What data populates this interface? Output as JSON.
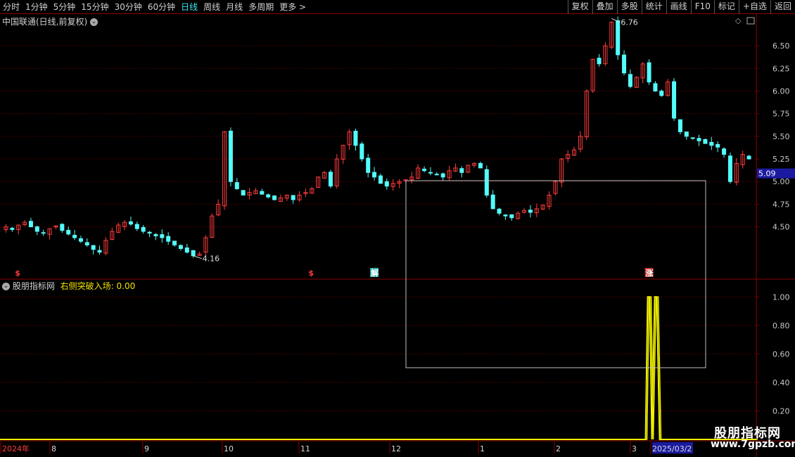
{
  "toolbar": {
    "periods": [
      "分时",
      "1分钟",
      "5分钟",
      "15分钟",
      "30分钟",
      "60分钟",
      "日线",
      "周线",
      "月线",
      "多周期",
      "更多 >"
    ],
    "active_period": "日线",
    "buttons": [
      "复权",
      "叠加",
      "多股",
      "统计",
      "画线",
      "F10",
      "标记",
      "+自选",
      "返回"
    ]
  },
  "main_chart": {
    "title": "中国联通(日线,前复权)",
    "price_ticks": [
      "6.50",
      "6.25",
      "6.00",
      "5.75",
      "5.50",
      "5.25",
      "5.00",
      "4.75",
      "4.50"
    ],
    "high_label": "6.76",
    "low_label": "4.16",
    "last_price": "5.09",
    "markers": [
      "$",
      "$",
      "解",
      "涨"
    ]
  },
  "indicator": {
    "name": "股朋指标网",
    "formula_label": "右侧突破入场: 0.00",
    "ticks": [
      "1.00",
      "0.80",
      "0.60",
      "0.40",
      "0.20"
    ]
  },
  "time_axis": {
    "labels": [
      "2024年",
      "8",
      "9",
      "10",
      "11",
      "12",
      "1",
      "2",
      "3",
      "2025/03/2"
    ]
  },
  "watermark": {
    "site_name": "股朋指标网",
    "url": "www.7gpzb.com"
  },
  "colors": {
    "up": "#ff3c3c",
    "down": "#54fcfc",
    "grid": "#8b0000",
    "signal": "#f0f000",
    "last_price_bg": "#1a1aa0"
  },
  "chart_data": {
    "type": "candlestick",
    "price_range": [
      4.0,
      6.85
    ],
    "indicator_range": [
      0,
      1.1
    ],
    "price_path": [
      4.5,
      4.47,
      4.52,
      4.55,
      4.5,
      4.45,
      4.43,
      4.48,
      4.51,
      4.46,
      4.42,
      4.38,
      4.34,
      4.3,
      4.25,
      4.22,
      4.35,
      4.45,
      4.52,
      4.55,
      4.53,
      4.48,
      4.45,
      4.43,
      4.4,
      4.38,
      4.34,
      4.3,
      4.26,
      4.22,
      4.18,
      4.2,
      4.38,
      4.62,
      4.75,
      5.55,
      5.0,
      4.92,
      4.85,
      4.88,
      4.9,
      4.86,
      4.83,
      4.8,
      4.82,
      4.85,
      4.8,
      4.85,
      4.88,
      4.92,
      5.05,
      5.1,
      4.95,
      5.25,
      5.4,
      5.55,
      5.4,
      5.25,
      5.1,
      5.05,
      4.98,
      4.95,
      4.98,
      5.0,
      5.02,
      5.05,
      5.15,
      5.12,
      5.1,
      5.08,
      5.05,
      5.12,
      5.15,
      5.1,
      5.18,
      5.2,
      5.15,
      4.85,
      4.7,
      4.65,
      4.62,
      4.6,
      4.65,
      4.68,
      4.66,
      4.7,
      4.74,
      4.85,
      5.0,
      5.25,
      5.3,
      5.35,
      5.5,
      6.0,
      6.35,
      6.3,
      6.5,
      6.76,
      6.4,
      6.2,
      6.05,
      6.15,
      6.3,
      6.1,
      6.0,
      5.95,
      6.1,
      5.7,
      5.55,
      5.5,
      5.48,
      5.45,
      5.42,
      5.4,
      5.38,
      5.3,
      5.0,
      5.2,
      5.3,
      5.25
    ],
    "candle_count": 120,
    "indicator_series": {
      "name": "右侧突破入场",
      "values": [
        0,
        1,
        0,
        1,
        0
      ]
    }
  }
}
